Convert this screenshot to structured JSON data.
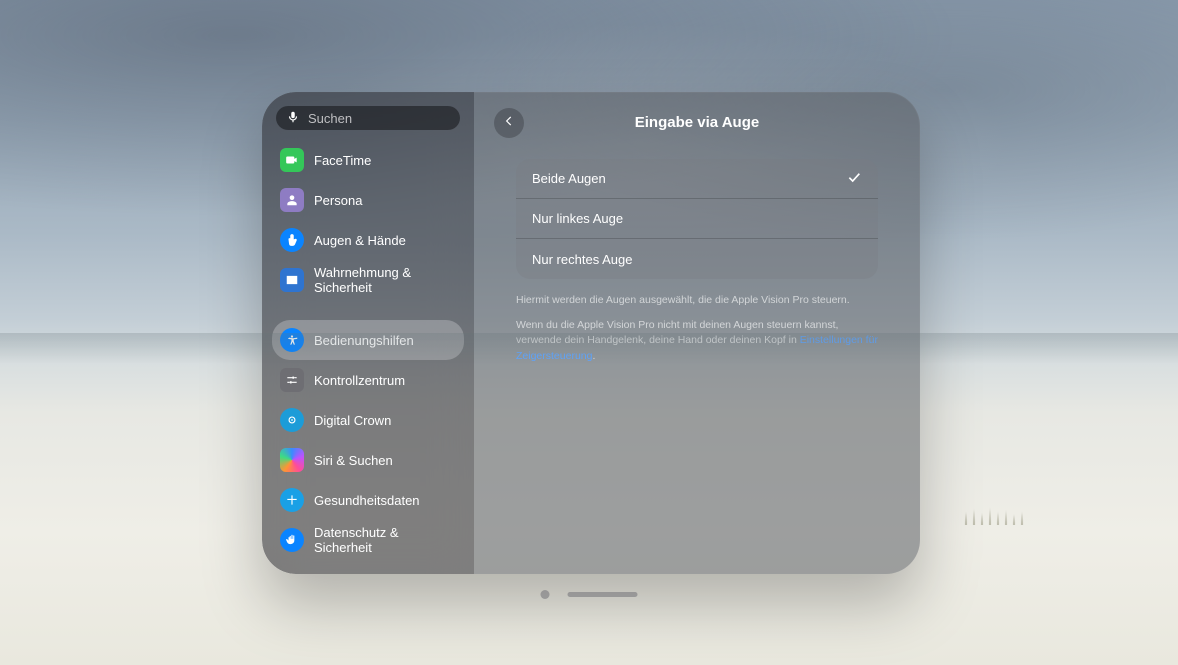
{
  "search": {
    "placeholder": "Suchen"
  },
  "sidebar": {
    "items": [
      {
        "label": "FaceTime"
      },
      {
        "label": "Persona"
      },
      {
        "label": "Augen & Hände"
      },
      {
        "label": "Wahrnehmung & Sicherheit"
      },
      {
        "label": "Bedienungshilfen"
      },
      {
        "label": "Kontrollzentrum"
      },
      {
        "label": "Digital Crown"
      },
      {
        "label": "Siri & Suchen"
      },
      {
        "label": "Gesundheitsdaten"
      },
      {
        "label": "Datenschutz & Sicherheit"
      }
    ],
    "selected_index": 4
  },
  "header": {
    "title": "Eingabe via Auge"
  },
  "options": [
    {
      "label": "Beide Augen",
      "selected": true
    },
    {
      "label": "Nur linkes Auge",
      "selected": false
    },
    {
      "label": "Nur rechtes Auge",
      "selected": false
    }
  ],
  "footnotes": {
    "line1": "Hiermit werden die Augen ausgewählt, die die Apple Vision Pro steuern.",
    "line2_a": "Wenn du die Apple Vision Pro nicht mit deinen Augen steuern kannst, verwende dein Handgelenk, deine Hand oder deinen Kopf in ",
    "link": "Einstellungen für Zeigersteuerung",
    "period": "."
  }
}
